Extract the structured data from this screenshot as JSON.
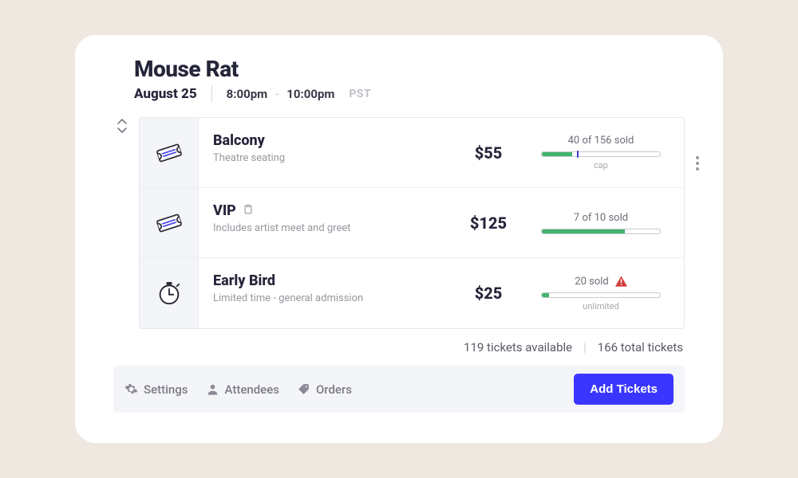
{
  "header": {
    "title": "Mouse Rat",
    "date": "August 25",
    "start_time": "8:00pm",
    "end_time": "10:00pm",
    "timezone": "PST"
  },
  "tickets": [
    {
      "name": "Balcony",
      "desc": "Theatre seating",
      "price": "$55",
      "sold_label": "40 of 156 sold",
      "fill_pct": 26,
      "cap_pct": 30,
      "cap_label": "cap",
      "icon": "ticket"
    },
    {
      "name": "VIP",
      "desc": "Includes artist meet and greet",
      "price": "$125",
      "sold_label": "7 of 10 sold",
      "fill_pct": 70,
      "icon": "ticket",
      "badge": "clipboard"
    },
    {
      "name": "Early Bird",
      "desc": "Limited time - general admission",
      "price": "$25",
      "sold_label": "20 sold",
      "fill_pct": 6,
      "unlimited_label": "unlimited",
      "icon": "clock",
      "warn": true
    }
  ],
  "totals": {
    "available": "119 tickets available",
    "total": "166 total tickets"
  },
  "footer": {
    "settings": "Settings",
    "attendees": "Attendees",
    "orders": "Orders",
    "add": "Add Tickets"
  }
}
